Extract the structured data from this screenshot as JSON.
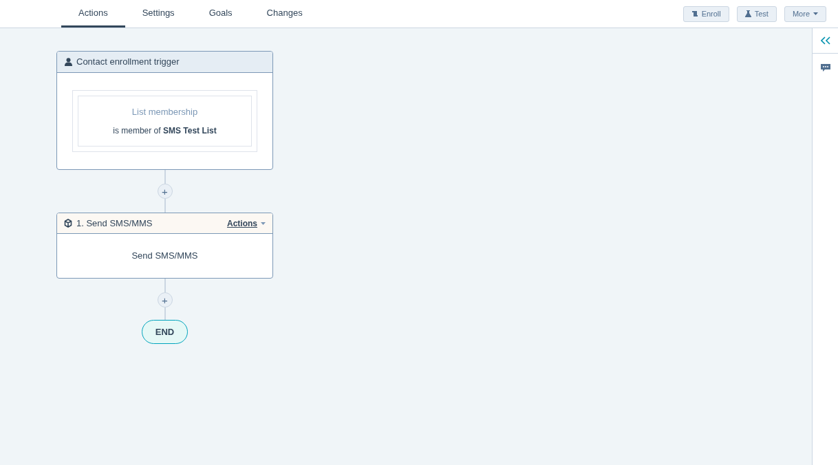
{
  "tabs": [
    {
      "label": "Actions",
      "selected": true
    },
    {
      "label": "Settings",
      "selected": false
    },
    {
      "label": "Goals",
      "selected": false
    },
    {
      "label": "Changes",
      "selected": false
    }
  ],
  "toolbar_buttons": [
    {
      "kind": "enroll",
      "label": "Enroll"
    },
    {
      "kind": "test",
      "label": "Test"
    },
    {
      "kind": "more",
      "label": "More"
    }
  ],
  "trigger": {
    "title": "Contact enrollment trigger",
    "filter_label": "List membership",
    "filter_text": "is member of **SMS Test List**"
  },
  "add_buttons": [
    "+",
    "+"
  ],
  "action": {
    "title": "1. Send SMS/MMS",
    "menu": "Actions",
    "body": "Send SMS/MMS"
  },
  "end": "END"
}
